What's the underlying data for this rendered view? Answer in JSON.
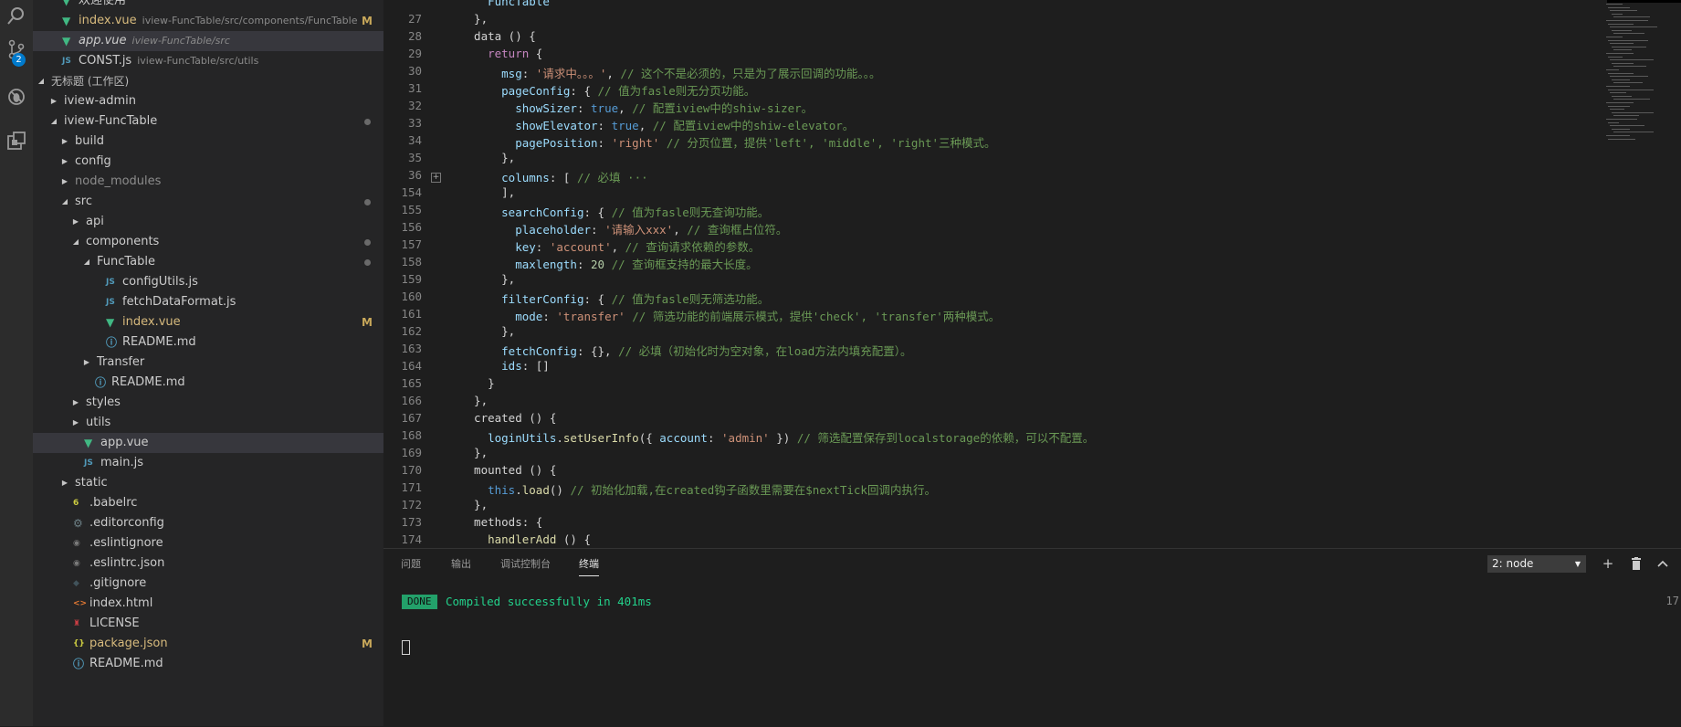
{
  "activity": {
    "badge": "2"
  },
  "explorer": {
    "rows": [
      {
        "name": "欢迎使用",
        "path": "",
        "icon": "vue",
        "stat": "",
        "dot": false,
        "indent": 1,
        "arrow": "",
        "selected": false
      },
      {
        "name": "index.vue",
        "path": "iview-FuncTable/src/components/FuncTable",
        "icon": "vue",
        "stat": "M",
        "dot": false,
        "indent": 1,
        "arrow": "",
        "selected": false
      },
      {
        "name": "app.vue",
        "path": "iview-FuncTable/src",
        "icon": "vue",
        "stat": "",
        "dot": false,
        "indent": 1,
        "arrow": "",
        "selected": true
      },
      {
        "name": "CONST.js",
        "path": "iview-FuncTable/src/utils",
        "icon": "js",
        "stat": "",
        "dot": false,
        "indent": 1,
        "arrow": "close",
        "selected": false
      },
      {
        "name": "无标题 (工作区)",
        "path": "",
        "icon": "",
        "stat": "",
        "dot": false,
        "indent": 0,
        "arrow": "open",
        "selected": false,
        "section": true
      },
      {
        "name": "iview-admin",
        "path": "",
        "icon": "",
        "stat": "",
        "dot": false,
        "indent": 1,
        "arrow": "closed",
        "selected": false
      },
      {
        "name": "iview-FuncTable",
        "path": "",
        "icon": "",
        "stat": "",
        "dot": true,
        "indent": 1,
        "arrow": "open",
        "selected": false
      },
      {
        "name": "build",
        "path": "",
        "icon": "",
        "stat": "",
        "dot": false,
        "indent": 2,
        "arrow": "closed",
        "selected": false
      },
      {
        "name": "config",
        "path": "",
        "icon": "",
        "stat": "",
        "dot": false,
        "indent": 2,
        "arrow": "closed",
        "selected": false
      },
      {
        "name": "node_modules",
        "path": "",
        "icon": "",
        "stat": "",
        "dot": false,
        "indent": 2,
        "arrow": "closed",
        "selected": false,
        "dim": true
      },
      {
        "name": "src",
        "path": "",
        "icon": "",
        "stat": "",
        "dot": true,
        "indent": 2,
        "arrow": "open",
        "selected": false
      },
      {
        "name": "api",
        "path": "",
        "icon": "",
        "stat": "",
        "dot": false,
        "indent": 3,
        "arrow": "closed",
        "selected": false
      },
      {
        "name": "components",
        "path": "",
        "icon": "",
        "stat": "",
        "dot": true,
        "indent": 3,
        "arrow": "open",
        "selected": false
      },
      {
        "name": "FuncTable",
        "path": "",
        "icon": "",
        "stat": "",
        "dot": true,
        "indent": 4,
        "arrow": "open",
        "selected": false
      },
      {
        "name": "configUtils.js",
        "path": "",
        "icon": "js",
        "stat": "",
        "dot": false,
        "indent": 5,
        "arrow": "",
        "selected": false
      },
      {
        "name": "fetchDataFormat.js",
        "path": "",
        "icon": "js",
        "stat": "",
        "dot": false,
        "indent": 5,
        "arrow": "",
        "selected": false
      },
      {
        "name": "index.vue",
        "path": "",
        "icon": "vue",
        "stat": "M",
        "dot": false,
        "indent": 5,
        "arrow": "",
        "selected": false
      },
      {
        "name": "README.md",
        "path": "",
        "icon": "info",
        "stat": "",
        "dot": false,
        "indent": 5,
        "arrow": "",
        "selected": false
      },
      {
        "name": "Transfer",
        "path": "",
        "icon": "",
        "stat": "",
        "dot": false,
        "indent": 4,
        "arrow": "closed",
        "selected": false
      },
      {
        "name": "README.md",
        "path": "",
        "icon": "info",
        "stat": "",
        "dot": false,
        "indent": 4,
        "arrow": "",
        "selected": false
      },
      {
        "name": "styles",
        "path": "",
        "icon": "",
        "stat": "",
        "dot": false,
        "indent": 3,
        "arrow": "closed",
        "selected": false
      },
      {
        "name": "utils",
        "path": "",
        "icon": "",
        "stat": "",
        "dot": false,
        "indent": 3,
        "arrow": "closed",
        "selected": false
      },
      {
        "name": "app.vue",
        "path": "",
        "icon": "vue",
        "stat": "",
        "dot": false,
        "indent": 3,
        "arrow": "",
        "selected": true
      },
      {
        "name": "main.js",
        "path": "",
        "icon": "js",
        "stat": "",
        "dot": false,
        "indent": 3,
        "arrow": "",
        "selected": false
      },
      {
        "name": "static",
        "path": "",
        "icon": "",
        "stat": "",
        "dot": false,
        "indent": 2,
        "arrow": "closed",
        "selected": false
      },
      {
        "name": ".babelrc",
        "path": "",
        "icon": "babel",
        "stat": "",
        "dot": false,
        "indent": 2,
        "arrow": "",
        "selected": false
      },
      {
        "name": ".editorconfig",
        "path": "",
        "icon": "gear",
        "stat": "",
        "dot": false,
        "indent": 2,
        "arrow": "",
        "selected": false
      },
      {
        "name": ".eslintignore",
        "path": "",
        "icon": "eslint",
        "stat": "",
        "dot": false,
        "indent": 2,
        "arrow": "",
        "selected": false
      },
      {
        "name": ".eslintrc.json",
        "path": "",
        "icon": "eslint",
        "stat": "",
        "dot": false,
        "indent": 2,
        "arrow": "",
        "selected": false
      },
      {
        "name": ".gitignore",
        "path": "",
        "icon": "git",
        "stat": "",
        "dot": false,
        "indent": 2,
        "arrow": "",
        "selected": false
      },
      {
        "name": "index.html",
        "path": "",
        "icon": "html",
        "stat": "",
        "dot": false,
        "indent": 2,
        "arrow": "",
        "selected": false
      },
      {
        "name": "LICENSE",
        "path": "",
        "icon": "license",
        "stat": "",
        "dot": false,
        "indent": 2,
        "arrow": "",
        "selected": false
      },
      {
        "name": "package.json",
        "path": "",
        "icon": "json",
        "stat": "M",
        "dot": false,
        "indent": 2,
        "arrow": "",
        "selected": false
      },
      {
        "name": "README.md",
        "path": "",
        "icon": "info",
        "stat": "",
        "dot": false,
        "indent": 2,
        "arrow": "",
        "selected": false
      }
    ]
  },
  "editor": {
    "lines": [
      {
        "n": "",
        "fold": false,
        "t": [
          [
            "    ",
            ""
          ],
          [
            "FuncTable",
            "p"
          ]
        ]
      },
      {
        "n": "27",
        "fold": false,
        "t": [
          [
            "  },",
            ""
          ]
        ]
      },
      {
        "n": "28",
        "fold": false,
        "t": [
          [
            "  data () {",
            ""
          ]
        ]
      },
      {
        "n": "29",
        "fold": false,
        "t": [
          [
            "    ",
            ""
          ],
          [
            "return",
            "k"
          ],
          [
            " {",
            ""
          ]
        ]
      },
      {
        "n": "30",
        "fold": false,
        "t": [
          [
            "      ",
            ""
          ],
          [
            "msg",
            "p"
          ],
          [
            ": ",
            ""
          ],
          [
            "'请求中。。。'",
            "s"
          ],
          [
            ", ",
            ""
          ],
          [
            "// 这个不是必须的，只是为了展示回调的功能。。。",
            "c"
          ]
        ]
      },
      {
        "n": "31",
        "fold": false,
        "t": [
          [
            "      ",
            ""
          ],
          [
            "pageConfig",
            "p"
          ],
          [
            ": { ",
            ""
          ],
          [
            "// 值为fasle则无分页功能。",
            "c"
          ]
        ]
      },
      {
        "n": "32",
        "fold": false,
        "t": [
          [
            "        ",
            ""
          ],
          [
            "showSizer",
            "p"
          ],
          [
            ": ",
            ""
          ],
          [
            "true",
            "kb"
          ],
          [
            ", ",
            ""
          ],
          [
            "// 配置iview中的shiw-sizer。",
            "c"
          ]
        ]
      },
      {
        "n": "33",
        "fold": false,
        "t": [
          [
            "        ",
            ""
          ],
          [
            "showElevator",
            "p"
          ],
          [
            ": ",
            ""
          ],
          [
            "true",
            "kb"
          ],
          [
            ", ",
            ""
          ],
          [
            "// 配置iview中的shiw-elevator。",
            "c"
          ]
        ]
      },
      {
        "n": "34",
        "fold": false,
        "t": [
          [
            "        ",
            ""
          ],
          [
            "pagePosition",
            "p"
          ],
          [
            ": ",
            ""
          ],
          [
            "'right'",
            "s"
          ],
          [
            " ",
            ""
          ],
          [
            "// 分页位置，提供'left', 'middle', 'right'三种模式。",
            "c"
          ]
        ]
      },
      {
        "n": "35",
        "fold": false,
        "t": [
          [
            "      },",
            ""
          ]
        ]
      },
      {
        "n": "36",
        "fold": true,
        "t": [
          [
            "      ",
            ""
          ],
          [
            "columns",
            "p"
          ],
          [
            ": [ ",
            ""
          ],
          [
            "// 必填 ···",
            "c"
          ]
        ]
      },
      {
        "n": "154",
        "fold": false,
        "t": [
          [
            "      ],",
            ""
          ]
        ]
      },
      {
        "n": "155",
        "fold": false,
        "t": [
          [
            "      ",
            ""
          ],
          [
            "searchConfig",
            "p"
          ],
          [
            ": { ",
            ""
          ],
          [
            "// 值为fasle则无查询功能。",
            "c"
          ]
        ]
      },
      {
        "n": "156",
        "fold": false,
        "t": [
          [
            "        ",
            ""
          ],
          [
            "placeholder",
            "p"
          ],
          [
            ": ",
            ""
          ],
          [
            "'请输入xxx'",
            "s"
          ],
          [
            ", ",
            ""
          ],
          [
            "// 查询框占位符。",
            "c"
          ]
        ]
      },
      {
        "n": "157",
        "fold": false,
        "t": [
          [
            "        ",
            ""
          ],
          [
            "key",
            "p"
          ],
          [
            ": ",
            ""
          ],
          [
            "'account'",
            "s"
          ],
          [
            ", ",
            ""
          ],
          [
            "// 查询请求依赖的参数。",
            "c"
          ]
        ]
      },
      {
        "n": "158",
        "fold": false,
        "t": [
          [
            "        ",
            ""
          ],
          [
            "maxlength",
            "p"
          ],
          [
            ": ",
            ""
          ],
          [
            "20",
            "n"
          ],
          [
            " ",
            ""
          ],
          [
            "// 查询框支持的最大长度。",
            "c"
          ]
        ]
      },
      {
        "n": "159",
        "fold": false,
        "t": [
          [
            "      },",
            ""
          ]
        ]
      },
      {
        "n": "160",
        "fold": false,
        "t": [
          [
            "      ",
            ""
          ],
          [
            "filterConfig",
            "p"
          ],
          [
            ": { ",
            ""
          ],
          [
            "// 值为fasle则无筛选功能。",
            "c"
          ]
        ]
      },
      {
        "n": "161",
        "fold": false,
        "t": [
          [
            "        ",
            ""
          ],
          [
            "mode",
            "p"
          ],
          [
            ": ",
            ""
          ],
          [
            "'transfer'",
            "s"
          ],
          [
            " ",
            ""
          ],
          [
            "// 筛选功能的前端展示模式，提供'check', 'transfer'两种模式。",
            "c"
          ]
        ]
      },
      {
        "n": "162",
        "fold": false,
        "t": [
          [
            "      },",
            ""
          ]
        ]
      },
      {
        "n": "163",
        "fold": false,
        "t": [
          [
            "      ",
            ""
          ],
          [
            "fetchConfig",
            "p"
          ],
          [
            ": {}, ",
            ""
          ],
          [
            "// 必填（初始化时为空对象，在load方法内填充配置）。",
            "c"
          ]
        ]
      },
      {
        "n": "164",
        "fold": false,
        "t": [
          [
            "      ",
            ""
          ],
          [
            "ids",
            "p"
          ],
          [
            ": []",
            ""
          ]
        ]
      },
      {
        "n": "165",
        "fold": false,
        "t": [
          [
            "    }",
            ""
          ]
        ]
      },
      {
        "n": "166",
        "fold": false,
        "t": [
          [
            "  },",
            ""
          ]
        ]
      },
      {
        "n": "167",
        "fold": false,
        "t": [
          [
            "  created () {",
            ""
          ]
        ]
      },
      {
        "n": "168",
        "fold": false,
        "t": [
          [
            "    ",
            ""
          ],
          [
            "loginUtils",
            "p"
          ],
          [
            ".",
            ""
          ],
          [
            "setUserInfo",
            "f"
          ],
          [
            "({ ",
            ""
          ],
          [
            "account",
            "p"
          ],
          [
            ": ",
            ""
          ],
          [
            "'admin'",
            "s"
          ],
          [
            " }) ",
            ""
          ],
          [
            "// 筛选配置保存到localstorage的依赖，可以不配置。",
            "c"
          ]
        ]
      },
      {
        "n": "169",
        "fold": false,
        "t": [
          [
            "  },",
            ""
          ]
        ]
      },
      {
        "n": "170",
        "fold": false,
        "t": [
          [
            "  mounted () {",
            ""
          ]
        ]
      },
      {
        "n": "171",
        "fold": false,
        "t": [
          [
            "    ",
            ""
          ],
          [
            "this",
            "tw"
          ],
          [
            ".",
            ""
          ],
          [
            "load",
            "f"
          ],
          [
            "() ",
            ""
          ],
          [
            "// 初始化加载,在created钩子函数里需要在$nextTick回调内执行。",
            "c"
          ]
        ]
      },
      {
        "n": "172",
        "fold": false,
        "t": [
          [
            "  },",
            ""
          ]
        ]
      },
      {
        "n": "173",
        "fold": false,
        "t": [
          [
            "  methods: {",
            ""
          ]
        ]
      },
      {
        "n": "174",
        "fold": false,
        "t": [
          [
            "    ",
            ""
          ],
          [
            "handlerAdd",
            "f"
          ],
          [
            " () {",
            ""
          ]
        ]
      }
    ]
  },
  "panel": {
    "tabs": [
      "问题",
      "输出",
      "调试控制台",
      "终端"
    ],
    "active_tab": 3,
    "terminal_select": "2: node",
    "done_label": "DONE",
    "done_message": "Compiled successfully in 401ms",
    "right_number": "17"
  },
  "colors": {
    "accent": "#007acc",
    "done_green": "#23a16a",
    "modified": "#c8a85a",
    "vue_green": "#41b883"
  }
}
